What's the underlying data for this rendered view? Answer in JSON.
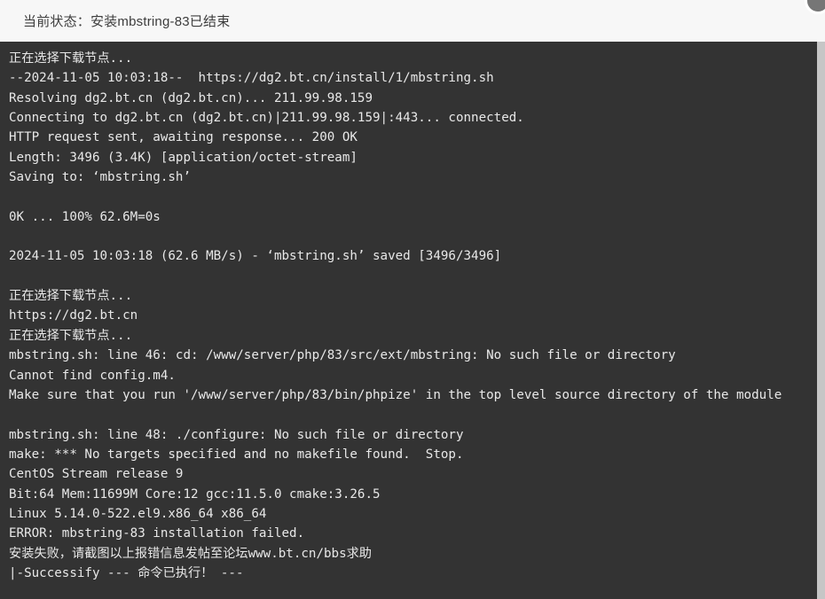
{
  "header": {
    "status_label": "当前状态：安装mbstring-83已结束",
    "badge_icon": "circle-avatar-icon",
    "background_color": "#f7f7f7",
    "text_color": "#3d3d3d"
  },
  "terminal": {
    "background_color": "#333333",
    "text_color": "#e8e8e8",
    "lines": [
      "正在选择下载节点...",
      "--2024-11-05 10:03:18--  https://dg2.bt.cn/install/1/mbstring.sh",
      "Resolving dg2.bt.cn (dg2.bt.cn)... 211.99.98.159",
      "Connecting to dg2.bt.cn (dg2.bt.cn)|211.99.98.159|:443... connected.",
      "HTTP request sent, awaiting response... 200 OK",
      "Length: 3496 (3.4K) [application/octet-stream]",
      "Saving to: ‘mbstring.sh’",
      "",
      "0K ... 100% 62.6M=0s",
      "",
      "2024-11-05 10:03:18 (62.6 MB/s) - ‘mbstring.sh’ saved [3496/3496]",
      "",
      "正在选择下载节点...",
      "https://dg2.bt.cn",
      "正在选择下载节点...",
      "mbstring.sh: line 46: cd: /www/server/php/83/src/ext/mbstring: No such file or directory",
      "Cannot find config.m4.",
      "Make sure that you run '/www/server/php/83/bin/phpize' in the top level source directory of the module",
      "",
      "mbstring.sh: line 48: ./configure: No such file or directory",
      "make: *** No targets specified and no makefile found.  Stop.",
      "CentOS Stream release 9",
      "Bit:64 Mem:11699M Core:12 gcc:11.5.0 cmake:3.26.5",
      "Linux 5.14.0-522.el9.x86_64 x86_64",
      "ERROR: mbstring-83 installation failed.",
      "安装失败，请截图以上报错信息发帖至论坛www.bt.cn/bbs求助",
      "|-Successify --- 命令已执行！ ---"
    ]
  },
  "scrollbar": {
    "track_color": "#d9d9d9",
    "thumb_color": "#c6c6c6"
  }
}
